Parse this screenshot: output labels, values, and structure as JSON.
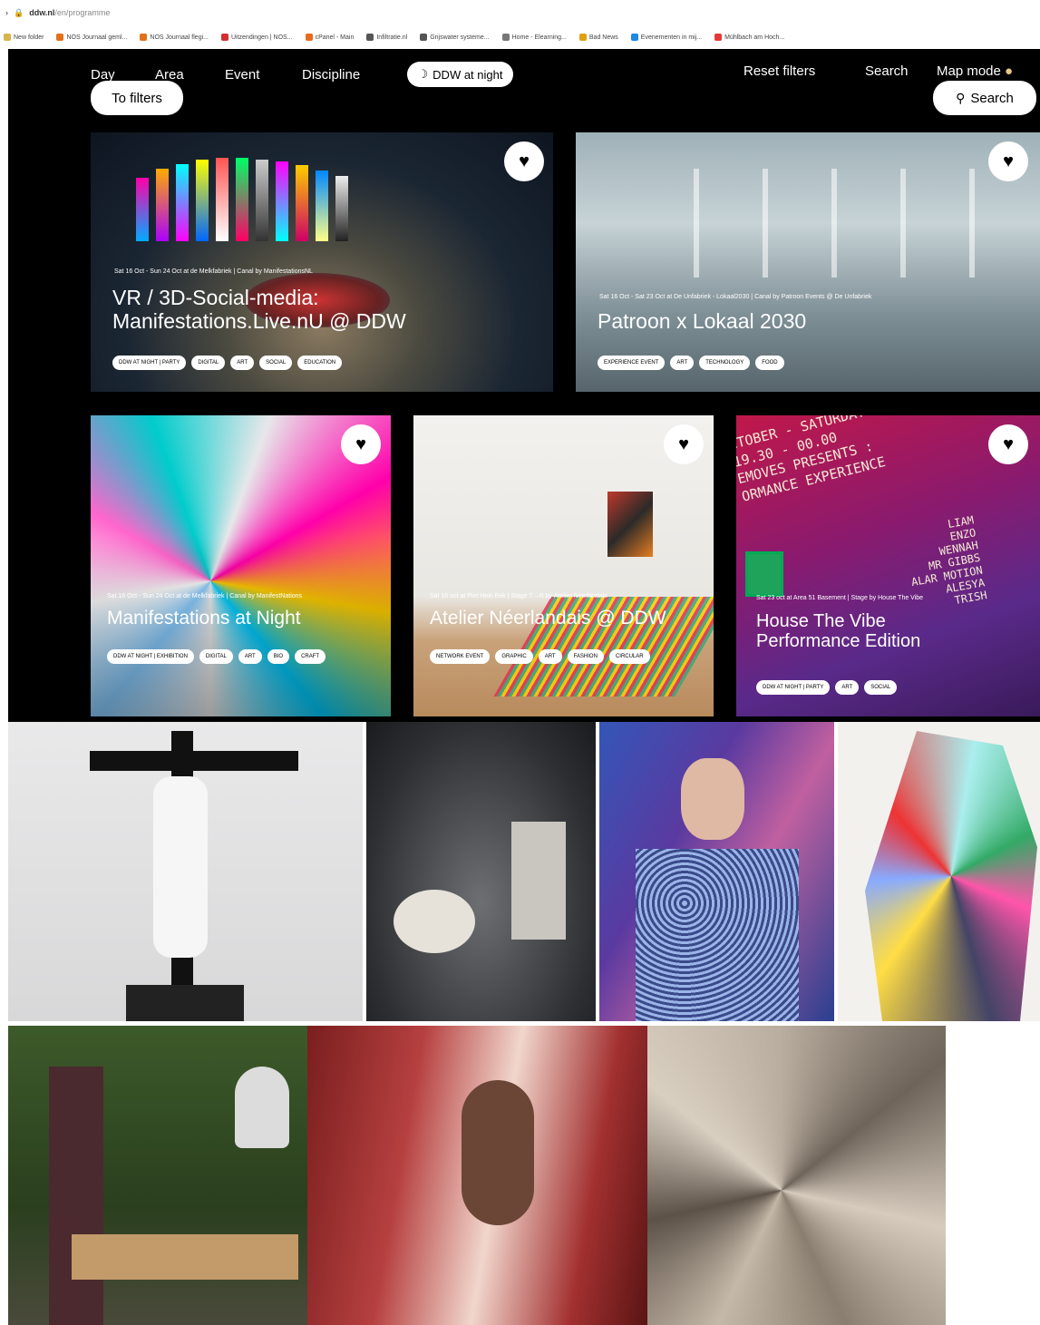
{
  "browser": {
    "domain": "ddw.nl",
    "path": "/en/programme"
  },
  "bookmarks": [
    {
      "label": "New folder",
      "color": "#d9b44a"
    },
    {
      "label": "NOS Journaal geml...",
      "color": "#e2701a"
    },
    {
      "label": "NOS Journaal flegi...",
      "color": "#e2701a"
    },
    {
      "label": "Uitzendingen | NOS...",
      "color": "#d32f2f"
    },
    {
      "label": "cPanel - Main",
      "color": "#e86b1f"
    },
    {
      "label": "Infiltratie.nl",
      "color": "#555"
    },
    {
      "label": "Grijswater systeme...",
      "color": "#555"
    },
    {
      "label": "Home - Elearning...",
      "color": "#777"
    },
    {
      "label": "Bad News",
      "color": "#e0a010"
    },
    {
      "label": "Evenementen in mij...",
      "color": "#1e88e5"
    },
    {
      "label": "Mühlbach am Hoch...",
      "color": "#e53935"
    }
  ],
  "nav": {
    "day": "Day",
    "area": "Area",
    "event": "Event",
    "discipline": "Discipline",
    "ddw_night": "DDW at night",
    "reset": "Reset filters",
    "search": "Search",
    "map_mode": "Map mode",
    "to_filters": "To filters",
    "search_button": "Search"
  },
  "cards": [
    {
      "meta": "Sat 16 Oct - Sun 24 Oct at de Melkfabriek | Canal by ManifestationsNL",
      "title_line1": "VR / 3D-Social-media:",
      "title_line2": "Manifestations.Live.nU @ DDW",
      "tags": [
        "DDW AT NIGHT | PARTY",
        "DIGITAL",
        "ART",
        "SOCIAL",
        "EDUCATION"
      ]
    },
    {
      "meta": "Sat 16 Oct - Sat 23 Oct at De Unfabriek - Lokaal2030 | Canal by Patroon Events @ De Unfabriek",
      "title_line1": "Patroon x Lokaal 2030",
      "tags": [
        "EXPERIENCE EVENT",
        "ART",
        "TECHNOLOGY",
        "FOOD"
      ]
    },
    {
      "meta": "Sat 16 Oct - Sun 24 Oct at de Melkfabriek | Canal by ManifestNations",
      "title_line1": "Manifestations at Night",
      "tags": [
        "DDW AT NIGHT | EXHIBITION",
        "DIGITAL",
        "ART",
        "BIO",
        "CRAFT"
      ]
    },
    {
      "meta": "Sat 16 oct at Piet Hein Eek | Stage T→R by Atelier Néerlandais",
      "title_line1": "Atelier Néerlandais @ DDW",
      "tags": [
        "NETWORK EVENT",
        "GRAPHIC",
        "ART",
        "FASHION",
        "CIRCULAR"
      ]
    },
    {
      "meta": "Sat 23 oct at Area 51 Basement | Stage by House The Vibe",
      "title_line1": "House The Vibe",
      "title_line2": "Performance Edition",
      "tags": [
        "DDW AT NIGHT | PARTY",
        "ART",
        "SOCIAL"
      ],
      "poster": [
        "CTOBER - SATURDAY",
        "19.30 - 00.00",
        "EMOVES PRESENTS :",
        "ORMANCE EXPERIENCE"
      ],
      "names": [
        "LIAM",
        "ENZO",
        "WENNAH",
        "MR GIBBS",
        "ALAR MOTION",
        "ALESYA",
        "TRISH"
      ]
    }
  ]
}
